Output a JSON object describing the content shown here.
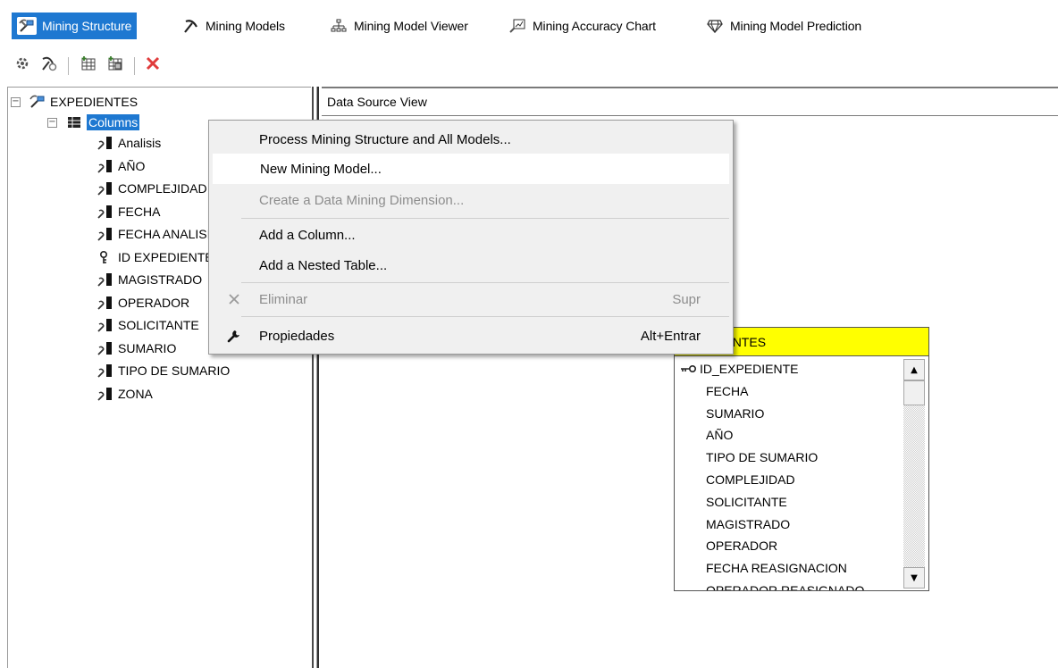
{
  "tabs": [
    {
      "label": "Mining Structure",
      "icon": "mining-structure-icon",
      "active": true
    },
    {
      "label": "Mining Models",
      "icon": "pickaxe-icon",
      "active": false
    },
    {
      "label": "Mining Model Viewer",
      "icon": "hierarchy-icon",
      "active": false
    },
    {
      "label": "Mining Accuracy Chart",
      "icon": "accuracy-chart-icon",
      "active": false
    },
    {
      "label": "Mining Model Prediction",
      "icon": "gem-icon",
      "active": false
    }
  ],
  "toolbar": {
    "buttons": [
      "process-icon",
      "mining-model-icon",
      "add-column-icon",
      "add-nested-table-icon",
      "delete-icon"
    ]
  },
  "tree": {
    "root": "EXPEDIENTES",
    "columns_node": "Columns",
    "columns": [
      {
        "label": "Analisis",
        "icon": "column-icon"
      },
      {
        "label": "AÑO",
        "icon": "column-icon"
      },
      {
        "label": "COMPLEJIDAD",
        "icon": "column-icon"
      },
      {
        "label": "FECHA",
        "icon": "column-icon"
      },
      {
        "label": "FECHA ANALISIS",
        "icon": "column-icon"
      },
      {
        "label": "ID EXPEDIENTE",
        "icon": "key-column-icon"
      },
      {
        "label": "MAGISTRADO",
        "icon": "column-icon"
      },
      {
        "label": "OPERADOR",
        "icon": "column-icon"
      },
      {
        "label": "SOLICITANTE",
        "icon": "column-icon"
      },
      {
        "label": "SUMARIO",
        "icon": "column-icon"
      },
      {
        "label": "TIPO DE SUMARIO",
        "icon": "column-icon"
      },
      {
        "label": "ZONA",
        "icon": "column-icon"
      }
    ]
  },
  "dsv": {
    "title": "Data Source View",
    "table": {
      "title": "EXPEDIENTES",
      "columns": [
        "ID_EXPEDIENTE",
        "FECHA",
        "SUMARIO",
        "AÑO",
        "TIPO DE SUMARIO",
        "COMPLEJIDAD",
        "SOLICITANTE",
        "MAGISTRADO",
        "OPERADOR",
        "FECHA REASIGNACION",
        "OPERADOR REASIGNADO"
      ]
    }
  },
  "context_menu": {
    "items": [
      {
        "label": "Process Mining Structure and All Models...",
        "shortcut": "",
        "enabled": true,
        "icon": ""
      },
      {
        "label": "New Mining Model...",
        "shortcut": "",
        "enabled": true,
        "icon": "",
        "hovered": true
      },
      {
        "label": "Create a Data Mining Dimension...",
        "shortcut": "",
        "enabled": false,
        "icon": ""
      },
      {
        "label": "Add a Column...",
        "shortcut": "",
        "enabled": true,
        "icon": ""
      },
      {
        "label": "Add a Nested Table...",
        "shortcut": "",
        "enabled": true,
        "icon": ""
      },
      {
        "label": "Eliminar",
        "shortcut": "Supr",
        "enabled": false,
        "icon": "close-icon"
      },
      {
        "label": "Propiedades",
        "shortcut": "Alt+Entrar",
        "enabled": true,
        "icon": "wrench-icon"
      }
    ]
  },
  "colors": {
    "selection": "#1e78d1",
    "table_header": "#ffff00",
    "menu_background": "#f0f0f0",
    "delete": "#e03c3c"
  }
}
